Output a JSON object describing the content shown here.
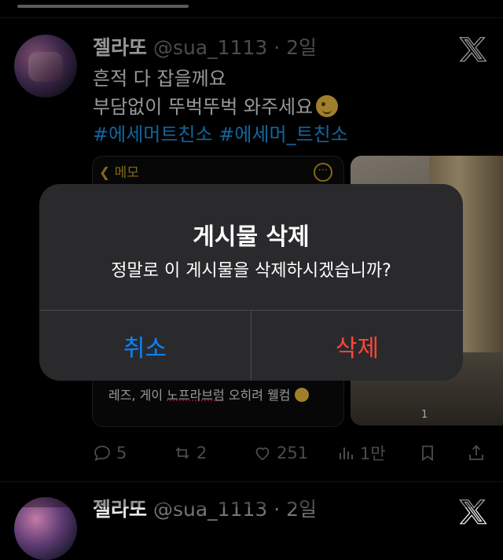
{
  "tweet": {
    "name": "젤라또",
    "handle": "@sua_1113",
    "separator": " · ",
    "time": "2일",
    "line1": "흔적 다 잡을께요",
    "line2": "부담없이 뚜벅뚜벅 와주세요",
    "hashtags": "#에세머트친소 #에세머_트친소",
    "memo_back": "메모",
    "memo_text_a": "레즈, 게이 ",
    "memo_text_b": "노프라브럼",
    "memo_text_c": " 오히려 웰컴",
    "media_hud": "1"
  },
  "actions": {
    "reply_count": "5",
    "retweet_count": "2",
    "like_count": "251",
    "views_count": "1만"
  },
  "next_tweet": {
    "name": "젤라또",
    "handle": "@sua_1113",
    "separator": " · ",
    "time": "2일"
  },
  "dialog": {
    "title": "게시물 삭제",
    "message": "정말로 이 게시물을 삭제하시겠습니까?",
    "cancel_label": "취소",
    "delete_label": "삭제"
  },
  "colors": {
    "background": "#000000",
    "dialog_bg": "#2a2a2c",
    "cancel": "#0a84ff",
    "delete": "#ff453a",
    "hashtag": "#1d9bf0",
    "muted": "#71767b"
  }
}
